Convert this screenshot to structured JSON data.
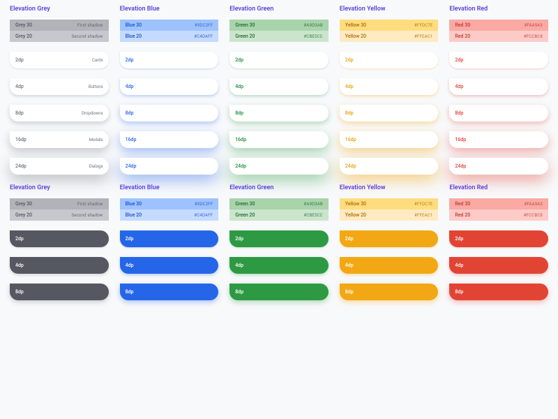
{
  "dp_levels": [
    "2dp",
    "4dp",
    "8dp",
    "16dp",
    "24dp"
  ],
  "dp_short": [
    "2dp",
    "4dp",
    "8dp"
  ],
  "usage_labels": [
    "Cards",
    "Buttons",
    "Dropdowns",
    "Modals",
    "Dialogs"
  ],
  "columns": [
    {
      "key": "grey",
      "title": "Elevation Grey",
      "swatches": [
        {
          "name": "Grey 30",
          "meta": "First shadow",
          "cls": "s-grey30"
        },
        {
          "name": "Grey 20",
          "meta": "Second shadow",
          "cls": "s-grey20"
        }
      ],
      "text_cls": "t-grey",
      "fill_cls": "f-grey",
      "show_usage": true
    },
    {
      "key": "blue",
      "title": "Elevation Blue",
      "swatches": [
        {
          "name": "Blue 30",
          "meta": "#9DC2FF",
          "cls": "s-blue30"
        },
        {
          "name": "Blue 20",
          "meta": "#C4DAFF",
          "cls": "s-blue20"
        }
      ],
      "text_cls": "t-blue",
      "fill_cls": "f-blue",
      "show_usage": false
    },
    {
      "key": "green",
      "title": "Elevation Green",
      "swatches": [
        {
          "name": "Green 30",
          "meta": "#A9D3AB",
          "cls": "s-green30"
        },
        {
          "name": "Green 20",
          "meta": "#CBE5CC",
          "cls": "s-green20"
        }
      ],
      "text_cls": "t-green",
      "fill_cls": "f-green",
      "show_usage": false
    },
    {
      "key": "yellow",
      "title": "Elevation Yellow",
      "swatches": [
        {
          "name": "Yellow 30",
          "meta": "#FFDC7E",
          "cls": "s-yellow30"
        },
        {
          "name": "Yellow 20",
          "meta": "#FFEAC1",
          "cls": "s-yellow20"
        }
      ],
      "text_cls": "t-yellow",
      "fill_cls": "f-yellow",
      "show_usage": false
    },
    {
      "key": "red",
      "title": "Elevation Red",
      "swatches": [
        {
          "name": "Red 30",
          "meta": "#FAA9A3",
          "cls": "s-red30"
        },
        {
          "name": "Red 20",
          "meta": "#FCCBC8",
          "cls": "s-red20"
        }
      ],
      "text_cls": "t-red",
      "fill_cls": "f-red",
      "show_usage": false
    }
  ]
}
